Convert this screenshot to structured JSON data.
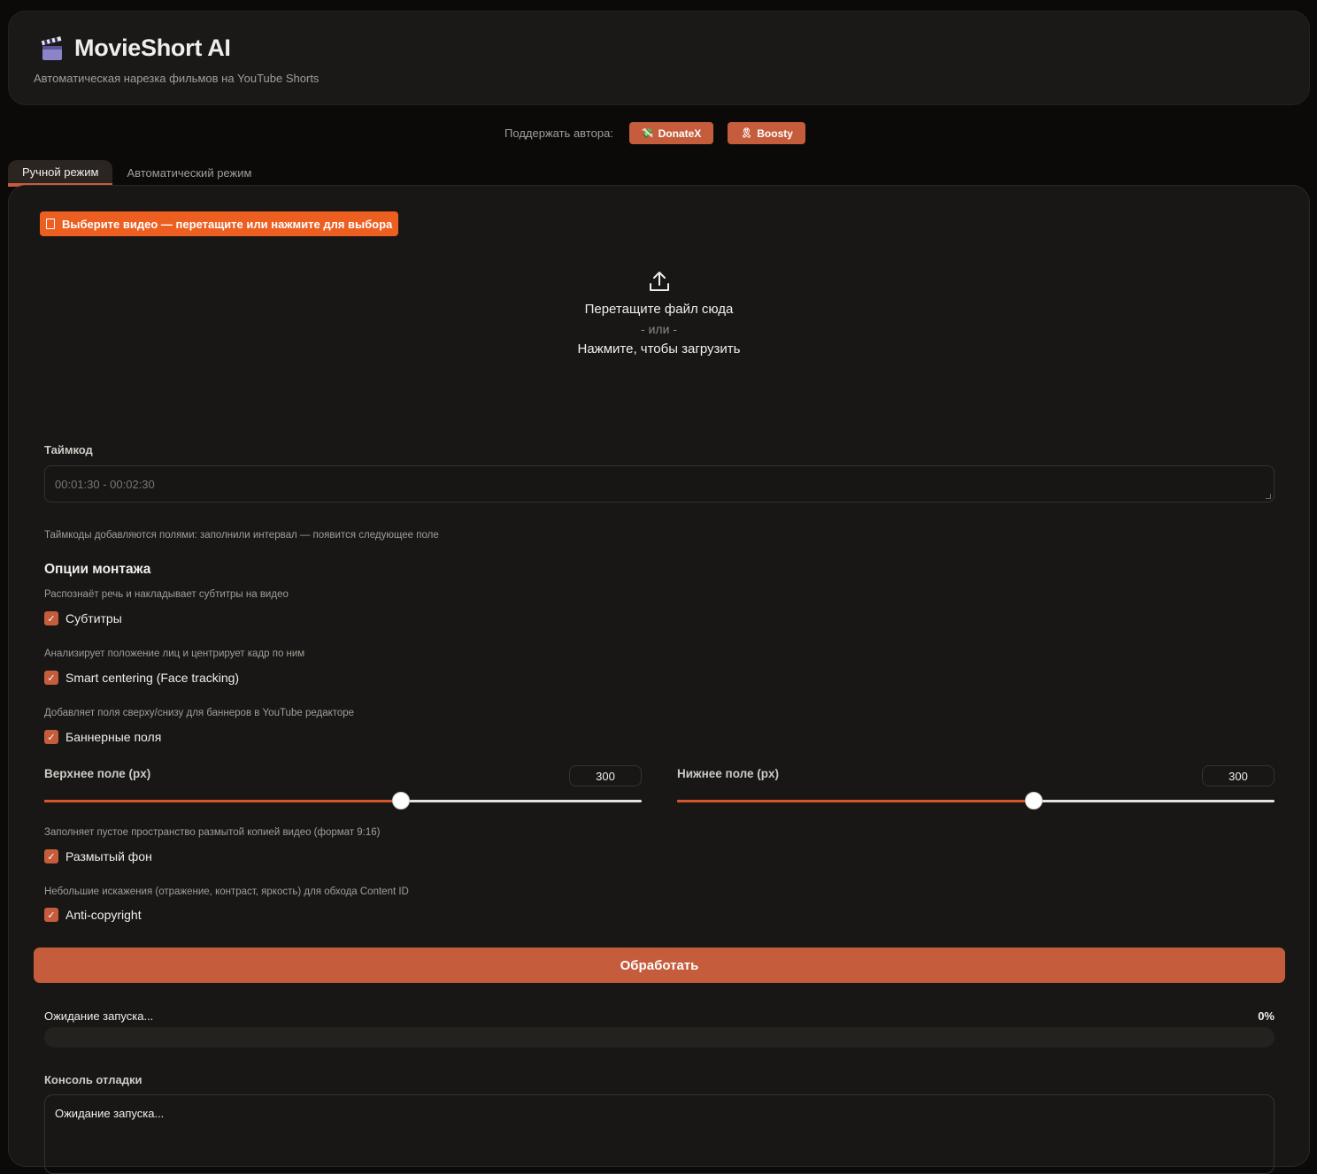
{
  "header": {
    "title": "MovieShort AI",
    "subtitle": "Автоматическая нарезка фильмов на YouTube Shorts",
    "icon": "clapperboard-icon"
  },
  "support": {
    "label": "Поддержать автора:",
    "buttons": [
      {
        "label": "DonateX",
        "icon": "money-icon"
      },
      {
        "label": "Boosty",
        "icon": "ribbon-icon"
      }
    ]
  },
  "tabs": [
    {
      "label": "Ручной режим",
      "active": true
    },
    {
      "label": "Автоматический режим",
      "active": false
    }
  ],
  "upload": {
    "chip_label": "Выберите видео — перетащите или нажмите для выбора",
    "drop_line1": "Перетащите файл сюда",
    "drop_or": "- или -",
    "drop_line2": "Нажмите, чтобы загрузить"
  },
  "timecode": {
    "label": "Таймкод",
    "placeholder": "00:01:30 - 00:02:30",
    "hint": "Таймкоды добавляются полями: заполнили интервал — появится следующее поле"
  },
  "options": {
    "title": "Опции монтажа",
    "subtitles": {
      "hint": "Распознаёт речь и накладывает субтитры на видео",
      "label": "Субтитры",
      "checked": true
    },
    "smart_centering": {
      "hint": "Анализирует положение лиц и центрирует кадр по ним",
      "label": "Smart centering (Face tracking)",
      "checked": true
    },
    "banners": {
      "hint": "Добавляет поля сверху/снизу для баннеров в YouTube редакторе",
      "label": "Баннерные поля",
      "checked": true
    },
    "top_margin": {
      "label": "Верхнее поле (px)",
      "value": "300",
      "fraction": 0.597
    },
    "bottom_margin": {
      "label": "Нижнее поле (px)",
      "value": "300",
      "fraction": 0.597
    },
    "blur_bg": {
      "hint": "Заполняет пустое пространство размытой копией видео (формат 9:16)",
      "label": "Размытый фон",
      "checked": true
    },
    "anti_copyright": {
      "hint": "Небольшие искажения (отражение, контраст, яркость) для обхода Content ID",
      "label": "Anti-copyright",
      "checked": true
    }
  },
  "process": {
    "button_label": "Обработать",
    "status": "Ожидание запуска...",
    "percent_label": "0%",
    "progress": 0
  },
  "console": {
    "label": "Консоль отладки",
    "text": "Ожидание запуска..."
  },
  "colors": {
    "accent": "#c55d3c",
    "chip": "#ec5f20",
    "background": "#0b0a09",
    "panel": "#181715"
  }
}
